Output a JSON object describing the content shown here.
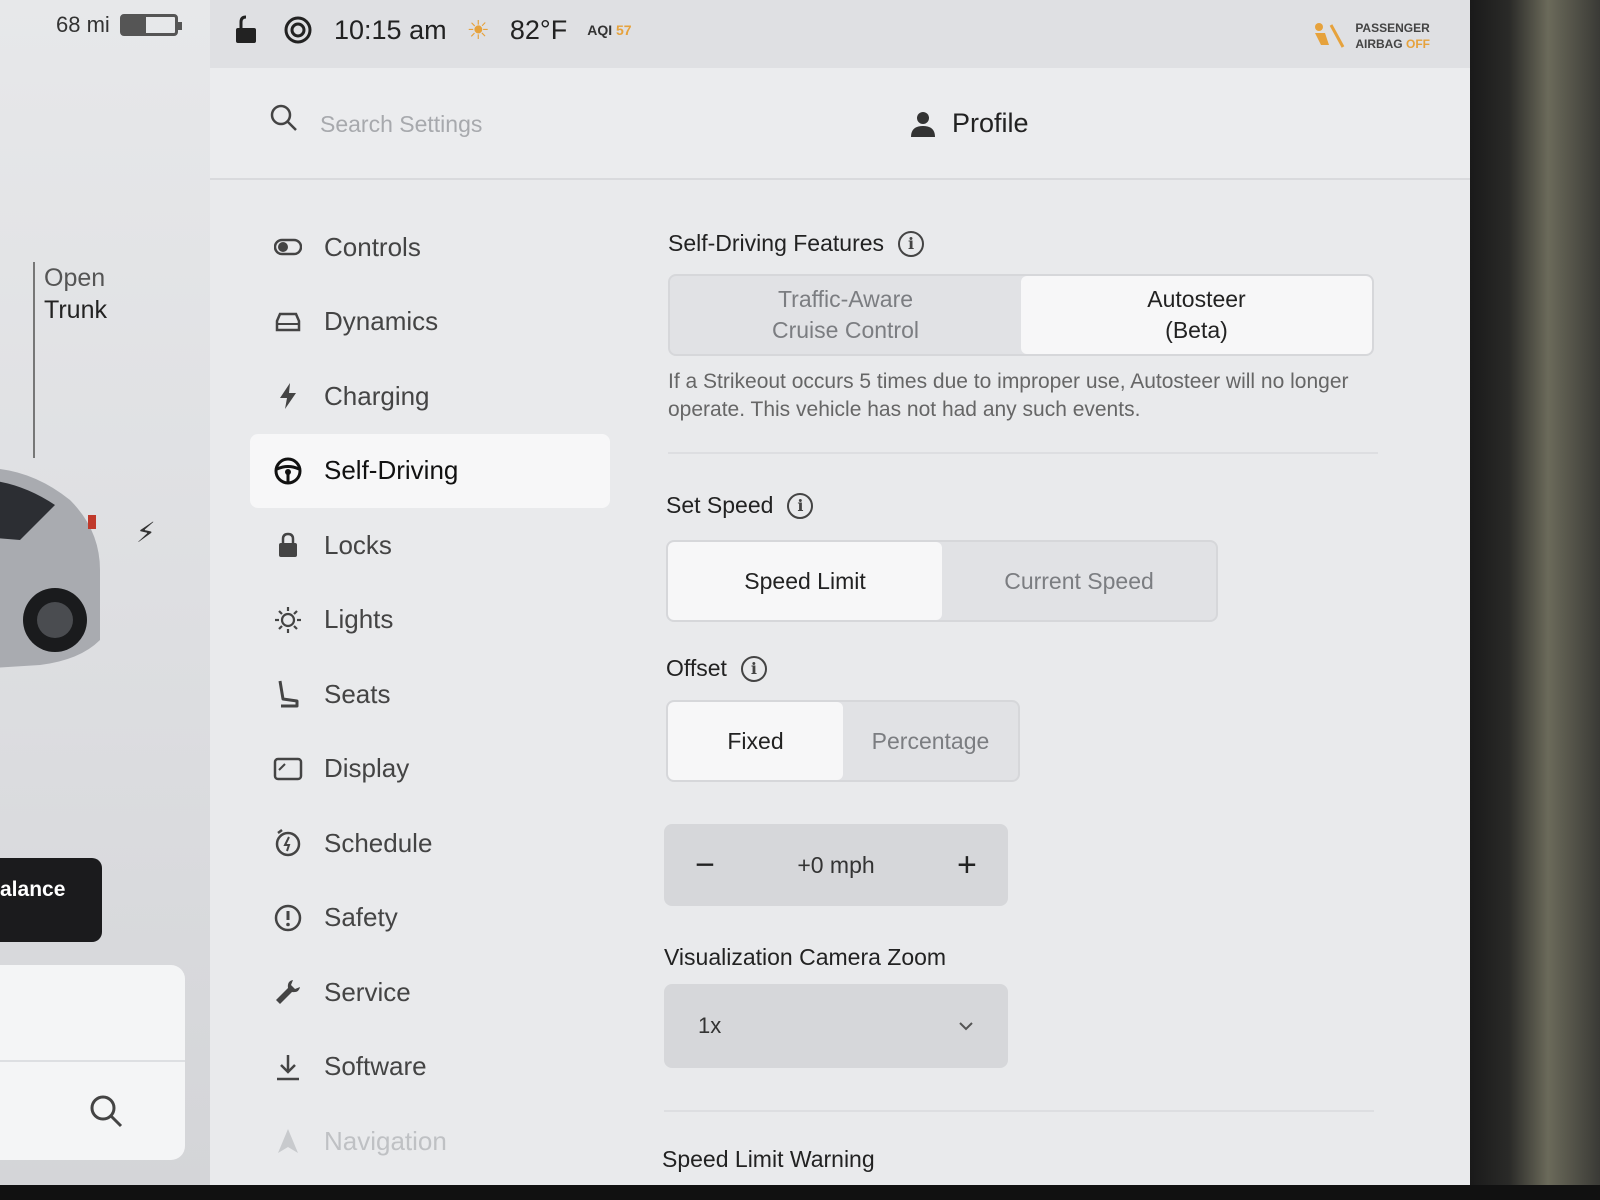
{
  "car": {
    "range": "68 mi",
    "battery_level": 0.45,
    "trunk_line1": "Open",
    "trunk_line2": "Trunk",
    "dark_button_label": "alance"
  },
  "topbar": {
    "time": "10:15 am",
    "temperature": "82°F",
    "aqi_label": "AQI",
    "aqi_value": "57",
    "airbag_line1": "PASSENGER",
    "airbag_line2": "AIRBAG",
    "airbag_status": "OFF"
  },
  "header": {
    "search_placeholder": "Search Settings",
    "profile_label": "Profile"
  },
  "sidebar": {
    "items": [
      {
        "label": "Controls",
        "icon": "toggle-icon"
      },
      {
        "label": "Dynamics",
        "icon": "car-front-icon"
      },
      {
        "label": "Charging",
        "icon": "bolt-icon"
      },
      {
        "label": "Self-Driving",
        "icon": "steering-wheel-icon"
      },
      {
        "label": "Locks",
        "icon": "lock-icon"
      },
      {
        "label": "Lights",
        "icon": "sun-icon"
      },
      {
        "label": "Seats",
        "icon": "seat-icon"
      },
      {
        "label": "Display",
        "icon": "display-icon"
      },
      {
        "label": "Schedule",
        "icon": "clock-icon"
      },
      {
        "label": "Safety",
        "icon": "alert-circle-icon"
      },
      {
        "label": "Service",
        "icon": "wrench-icon"
      },
      {
        "label": "Software",
        "icon": "download-icon"
      },
      {
        "label": "Navigation",
        "icon": "navigation-icon"
      }
    ],
    "active": "Self-Driving"
  },
  "content": {
    "features": {
      "title": "Self-Driving Features",
      "options": [
        {
          "line1": "Traffic-Aware",
          "line2": "Cruise Control"
        },
        {
          "line1": "Autosteer",
          "line2": "(Beta)"
        }
      ],
      "selected": "Autosteer (Beta)",
      "description": "If a Strikeout occurs 5 times due to improper use, Autosteer will no longer operate. This vehicle has not had any such events."
    },
    "set_speed": {
      "title": "Set Speed",
      "options": [
        "Speed Limit",
        "Current Speed"
      ],
      "selected": "Speed Limit"
    },
    "offset": {
      "title": "Offset",
      "options": [
        "Fixed",
        "Percentage"
      ],
      "selected": "Fixed",
      "value": "+0 mph",
      "minus": "−",
      "plus": "+"
    },
    "camera_zoom": {
      "title": "Visualization Camera Zoom",
      "value": "1x"
    },
    "speed_limit_warning": {
      "title": "Speed Limit Warning"
    }
  },
  "colors": {
    "accent_orange": "#e6a23c",
    "panel_bg": "#e9eaec",
    "selected_bg": "#f7f7f8"
  }
}
